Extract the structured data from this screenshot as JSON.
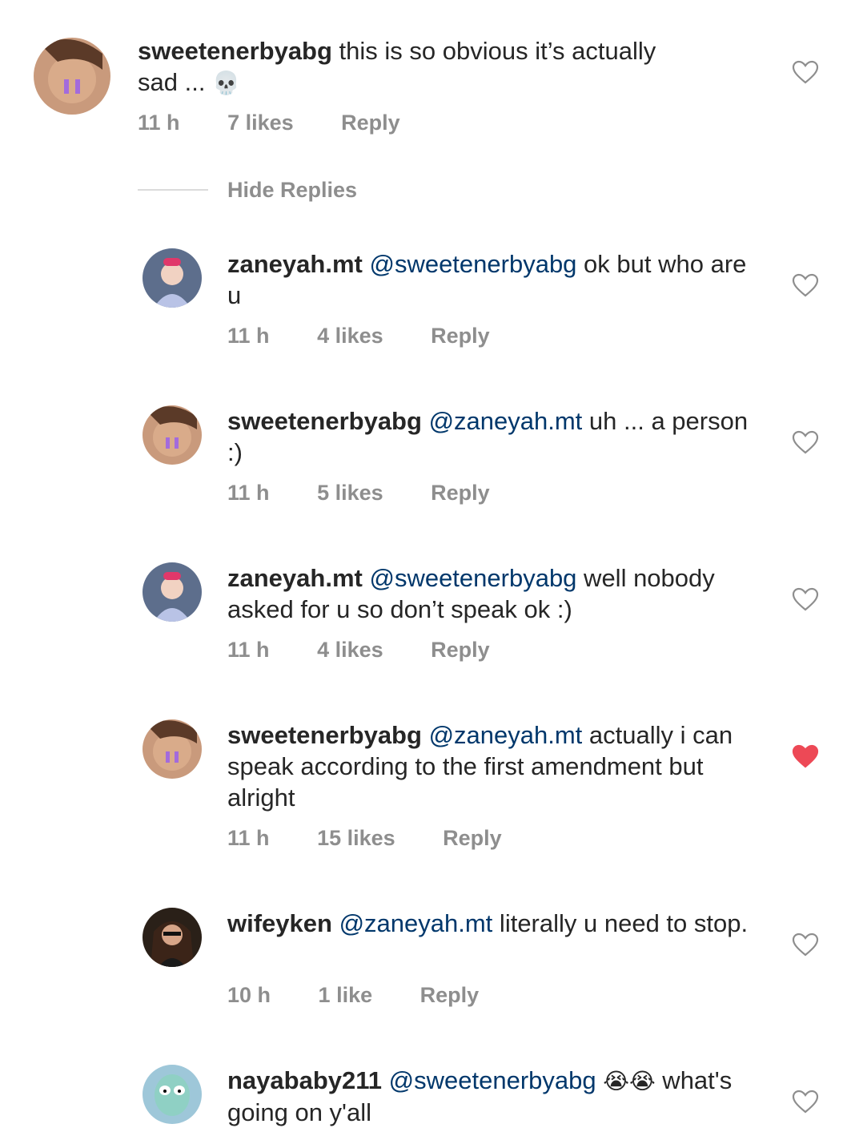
{
  "comments": [
    {
      "user": "sweetenerbyabg",
      "mention": "",
      "text": " this is so obvious it’s actually sad ... ",
      "emoji": "💀",
      "time": "11 h",
      "likes": "7 likes",
      "reply": "Reply",
      "liked": false,
      "avatar": "sweetener-avatar"
    },
    {
      "user": "zaneyah.mt",
      "mention": "@sweetenerbyabg",
      "text": " ok but who are u",
      "emoji": "",
      "time": "11 h",
      "likes": "4 likes",
      "reply": "Reply",
      "liked": false,
      "avatar": "zaneyah-avatar"
    },
    {
      "user": "sweetenerbyabg",
      "mention": "@zaneyah.mt",
      "text": " uh ... a person :)",
      "emoji": "",
      "time": "11 h",
      "likes": "5 likes",
      "reply": "Reply",
      "liked": false,
      "avatar": "sweetener-avatar"
    },
    {
      "user": "zaneyah.mt",
      "mention": "@sweetenerbyabg",
      "text": " well nobody asked for u so don’t speak ok :)",
      "emoji": "",
      "time": "11 h",
      "likes": "4 likes",
      "reply": "Reply",
      "liked": false,
      "avatar": "zaneyah-avatar"
    },
    {
      "user": "sweetenerbyabg",
      "mention": "@zaneyah.mt",
      "text": " actually i can speak according to the first amendment but alright",
      "emoji": "",
      "time": "11 h",
      "likes": "15 likes",
      "reply": "Reply",
      "liked": true,
      "avatar": "sweetener-avatar"
    },
    {
      "user": "wifeyken",
      "mention": "@zaneyah.mt",
      "text": " literally u need to stop.",
      "emoji": "",
      "time": "10 h",
      "likes": "1 like",
      "reply": "Reply",
      "liked": false,
      "avatar": "wifeyken-avatar"
    },
    {
      "user": "nayababy211",
      "mention": "@sweetenerbyabg",
      "text": " ",
      "emoji": "😭😭",
      "text2": " what's going on y'all",
      "time": "",
      "likes": "",
      "reply": "",
      "liked": false,
      "avatar": "nayababy-avatar"
    }
  ],
  "hide_replies": "Hide Replies",
  "colors": {
    "text": "#262626",
    "mention": "#00376b",
    "meta": "#8e8e8e",
    "liked": "#ed4956",
    "divider": "#dbdbdb"
  }
}
